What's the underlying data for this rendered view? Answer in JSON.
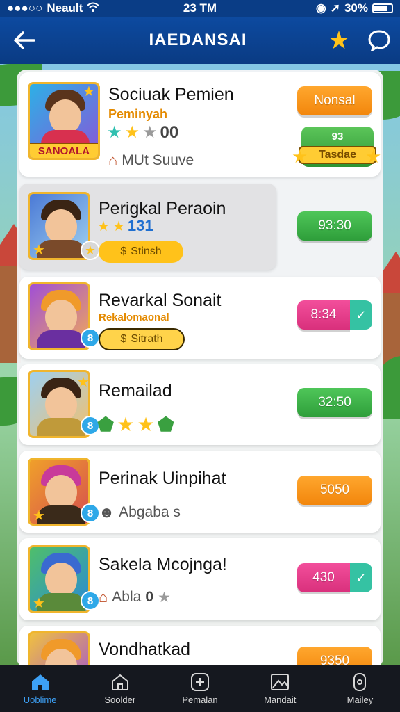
{
  "status_bar": {
    "carrier": "Neault",
    "time": "23 TM",
    "battery": "30%"
  },
  "header": {
    "title": "IAEDANSAI"
  },
  "rows": [
    {
      "name": "Sociuak Pemien",
      "subtitle": "Peminyah",
      "rating_value": "00",
      "meta": "MUt Suuve",
      "avatar_label": "SANOALA",
      "primary_button": "Nonsal",
      "secondary_button_top": "93",
      "secondary_button_banner": "Tasdae"
    },
    {
      "name": "Perigkal Peraoin",
      "rating_value": "131",
      "pill": "Stinsh",
      "button": "93:30"
    },
    {
      "name": "Revarkal Sonait",
      "subtitle": "Rekalomaonal",
      "pill": "Sitrath",
      "button": "8:34",
      "badge": "8"
    },
    {
      "name": "Remailad",
      "button": "32:50",
      "badge": "8"
    },
    {
      "name": "Perinak Uinpihat",
      "meta": "Abgaba s",
      "button": "5050",
      "badge": "8"
    },
    {
      "name": "Sakela Mcojnga!",
      "meta": "Abla",
      "meta_value": "0",
      "button": "430",
      "badge": "8"
    },
    {
      "name": "Vondhatkad",
      "button": "9350"
    }
  ],
  "bottom_nav": [
    {
      "label": "Uoblime",
      "icon": "home-icon",
      "active": true
    },
    {
      "label": "Soolder",
      "icon": "house-outline-icon",
      "active": false
    },
    {
      "label": "Pemalan",
      "icon": "plus-square-icon",
      "active": false
    },
    {
      "label": "Mandait",
      "icon": "image-frame-icon",
      "active": false
    },
    {
      "label": "Mailey",
      "icon": "phone-icon",
      "active": false
    }
  ],
  "colors": {
    "header_blue": "#0a3b83",
    "accent_orange": "#f2860c",
    "accent_green": "#2e9e3a",
    "accent_pink": "#d9307c",
    "nav_active": "#3da0f5"
  }
}
